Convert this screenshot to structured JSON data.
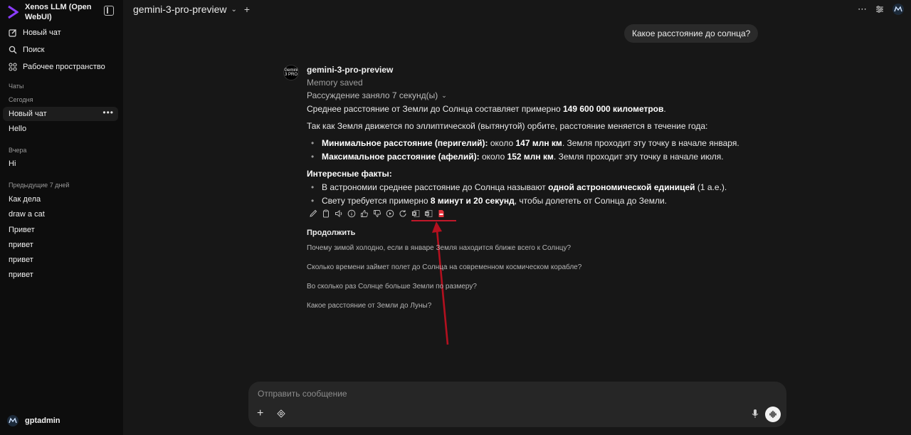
{
  "app": {
    "title": "Xenos LLM (Open WebUI)"
  },
  "sidebar": {
    "nav": [
      {
        "label": "Новый чат",
        "icon": "pencil-square-icon"
      },
      {
        "label": "Поиск",
        "icon": "search-icon"
      },
      {
        "label": "Рабочее пространство",
        "icon": "workspace-grid-icon"
      }
    ],
    "chats_label": "Чаты",
    "groups": [
      {
        "label": "Сегодня",
        "items": [
          "Новый чат",
          "Hello"
        ]
      },
      {
        "label": "Вчера",
        "items": [
          "Hi"
        ]
      },
      {
        "label": "Предыдущие 7 дней",
        "items": [
          "Как дела",
          "draw a cat",
          "Привет",
          "привет",
          "привет",
          "привет"
        ]
      }
    ],
    "active_chat_more": "•••",
    "user": {
      "name": "gptadmin"
    }
  },
  "header": {
    "model": "gemini-3-pro-preview",
    "chevron": "⌄",
    "plus": "+",
    "icons": [
      "more-horizontal-icon",
      "settings-sliders-icon",
      "user-avatar-icon"
    ]
  },
  "conversation": {
    "user_message": "Какое расстояние до солнца?",
    "assistant": {
      "avatar_text": "Gemini 3 PRO",
      "name": "gemini-3-pro-preview",
      "memory_status": "Memory saved",
      "reasoning": "Рассуждение заняло 7 секунд(ы)",
      "p1": {
        "a": "Среднее расстояние от Земли до Солнца составляет примерно ",
        "b": "149 600 000 километров",
        "c": "."
      },
      "p2": "Так как Земля движется по эллиптической (вытянутой) орбите, расстояние меняется в течение года:",
      "list1": [
        {
          "b": "Минимальное расстояние (перигелий):",
          "a": " около ",
          "b2": "147 млн км",
          "c": ". Земля проходит эту точку в начале января."
        },
        {
          "b": "Максимальное расстояние (афелий):",
          "a": " около ",
          "b2": "152 млн км",
          "c": ". Земля проходит эту точку в начале июля."
        }
      ],
      "facts_title": "Интересные факты:",
      "list2": [
        {
          "a": "В астрономии среднее расстояние до Солнца называют ",
          "b": "одной астрономической единицей",
          "c": " (1 а.е.)."
        },
        {
          "a": "Свету требуется примерно ",
          "b": "8 минут и 20 секунд",
          "c": ", чтобы долететь от Солнца до Земли."
        }
      ],
      "actions": [
        "edit-icon",
        "copy-icon",
        "speaker-icon",
        "info-icon",
        "thumbs-up-icon",
        "thumbs-down-icon",
        "continue-play-icon",
        "regenerate-icon",
        "excel-export-icon",
        "word-export-icon",
        "pdf-export-icon"
      ]
    },
    "continue": {
      "title": "Продолжить",
      "suggestions": [
        "Почему зимой холодно, если в январе Земля находится ближе всего к Солнцу?",
        "Сколько времени займет полет до Солнца на современном космическом корабле?",
        "Во сколько раз Солнце больше Земли по размеру?",
        "Какое расстояние от Земли до Луны?"
      ]
    }
  },
  "composer": {
    "placeholder": "Отправить сообщение",
    "plus": "+"
  },
  "colors": {
    "background": "#171717",
    "sidebar": "#0d0d0d",
    "brand_accent": "#8b3dff",
    "annotation_red": "#c0182a"
  }
}
